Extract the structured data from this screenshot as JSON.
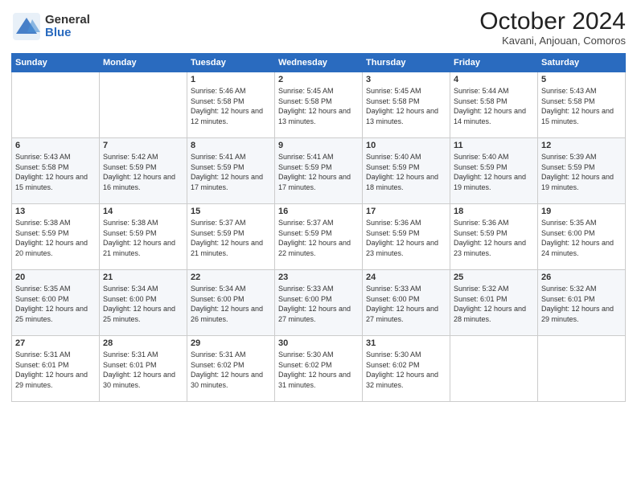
{
  "logo": {
    "general": "General",
    "blue": "Blue"
  },
  "header": {
    "title": "October 2024",
    "subtitle": "Kavani, Anjouan, Comoros"
  },
  "weekdays": [
    "Sunday",
    "Monday",
    "Tuesday",
    "Wednesday",
    "Thursday",
    "Friday",
    "Saturday"
  ],
  "weeks": [
    [
      {
        "day": "",
        "detail": ""
      },
      {
        "day": "",
        "detail": ""
      },
      {
        "day": "1",
        "detail": "Sunrise: 5:46 AM\nSunset: 5:58 PM\nDaylight: 12 hours and 12 minutes."
      },
      {
        "day": "2",
        "detail": "Sunrise: 5:45 AM\nSunset: 5:58 PM\nDaylight: 12 hours and 13 minutes."
      },
      {
        "day": "3",
        "detail": "Sunrise: 5:45 AM\nSunset: 5:58 PM\nDaylight: 12 hours and 13 minutes."
      },
      {
        "day": "4",
        "detail": "Sunrise: 5:44 AM\nSunset: 5:58 PM\nDaylight: 12 hours and 14 minutes."
      },
      {
        "day": "5",
        "detail": "Sunrise: 5:43 AM\nSunset: 5:58 PM\nDaylight: 12 hours and 15 minutes."
      }
    ],
    [
      {
        "day": "6",
        "detail": "Sunrise: 5:43 AM\nSunset: 5:58 PM\nDaylight: 12 hours and 15 minutes."
      },
      {
        "day": "7",
        "detail": "Sunrise: 5:42 AM\nSunset: 5:59 PM\nDaylight: 12 hours and 16 minutes."
      },
      {
        "day": "8",
        "detail": "Sunrise: 5:41 AM\nSunset: 5:59 PM\nDaylight: 12 hours and 17 minutes."
      },
      {
        "day": "9",
        "detail": "Sunrise: 5:41 AM\nSunset: 5:59 PM\nDaylight: 12 hours and 17 minutes."
      },
      {
        "day": "10",
        "detail": "Sunrise: 5:40 AM\nSunset: 5:59 PM\nDaylight: 12 hours and 18 minutes."
      },
      {
        "day": "11",
        "detail": "Sunrise: 5:40 AM\nSunset: 5:59 PM\nDaylight: 12 hours and 19 minutes."
      },
      {
        "day": "12",
        "detail": "Sunrise: 5:39 AM\nSunset: 5:59 PM\nDaylight: 12 hours and 19 minutes."
      }
    ],
    [
      {
        "day": "13",
        "detail": "Sunrise: 5:38 AM\nSunset: 5:59 PM\nDaylight: 12 hours and 20 minutes."
      },
      {
        "day": "14",
        "detail": "Sunrise: 5:38 AM\nSunset: 5:59 PM\nDaylight: 12 hours and 21 minutes."
      },
      {
        "day": "15",
        "detail": "Sunrise: 5:37 AM\nSunset: 5:59 PM\nDaylight: 12 hours and 21 minutes."
      },
      {
        "day": "16",
        "detail": "Sunrise: 5:37 AM\nSunset: 5:59 PM\nDaylight: 12 hours and 22 minutes."
      },
      {
        "day": "17",
        "detail": "Sunrise: 5:36 AM\nSunset: 5:59 PM\nDaylight: 12 hours and 23 minutes."
      },
      {
        "day": "18",
        "detail": "Sunrise: 5:36 AM\nSunset: 5:59 PM\nDaylight: 12 hours and 23 minutes."
      },
      {
        "day": "19",
        "detail": "Sunrise: 5:35 AM\nSunset: 6:00 PM\nDaylight: 12 hours and 24 minutes."
      }
    ],
    [
      {
        "day": "20",
        "detail": "Sunrise: 5:35 AM\nSunset: 6:00 PM\nDaylight: 12 hours and 25 minutes."
      },
      {
        "day": "21",
        "detail": "Sunrise: 5:34 AM\nSunset: 6:00 PM\nDaylight: 12 hours and 25 minutes."
      },
      {
        "day": "22",
        "detail": "Sunrise: 5:34 AM\nSunset: 6:00 PM\nDaylight: 12 hours and 26 minutes."
      },
      {
        "day": "23",
        "detail": "Sunrise: 5:33 AM\nSunset: 6:00 PM\nDaylight: 12 hours and 27 minutes."
      },
      {
        "day": "24",
        "detail": "Sunrise: 5:33 AM\nSunset: 6:00 PM\nDaylight: 12 hours and 27 minutes."
      },
      {
        "day": "25",
        "detail": "Sunrise: 5:32 AM\nSunset: 6:01 PM\nDaylight: 12 hours and 28 minutes."
      },
      {
        "day": "26",
        "detail": "Sunrise: 5:32 AM\nSunset: 6:01 PM\nDaylight: 12 hours and 29 minutes."
      }
    ],
    [
      {
        "day": "27",
        "detail": "Sunrise: 5:31 AM\nSunset: 6:01 PM\nDaylight: 12 hours and 29 minutes."
      },
      {
        "day": "28",
        "detail": "Sunrise: 5:31 AM\nSunset: 6:01 PM\nDaylight: 12 hours and 30 minutes."
      },
      {
        "day": "29",
        "detail": "Sunrise: 5:31 AM\nSunset: 6:02 PM\nDaylight: 12 hours and 30 minutes."
      },
      {
        "day": "30",
        "detail": "Sunrise: 5:30 AM\nSunset: 6:02 PM\nDaylight: 12 hours and 31 minutes."
      },
      {
        "day": "31",
        "detail": "Sunrise: 5:30 AM\nSunset: 6:02 PM\nDaylight: 12 hours and 32 minutes."
      },
      {
        "day": "",
        "detail": ""
      },
      {
        "day": "",
        "detail": ""
      }
    ]
  ]
}
